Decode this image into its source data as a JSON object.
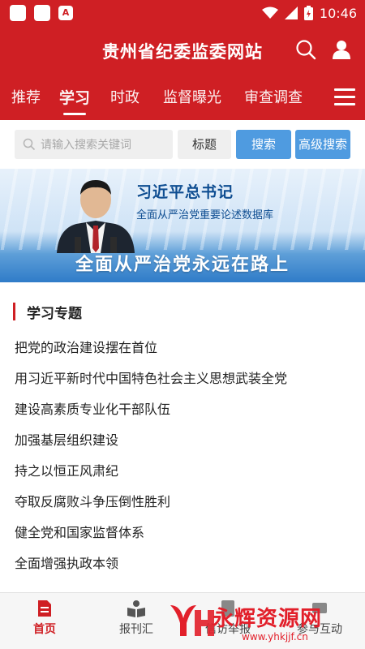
{
  "status_bar": {
    "time": "10:46",
    "notif_badge": "A"
  },
  "header": {
    "title": "贵州省纪委监委网站",
    "icons": [
      "search-icon",
      "user-icon"
    ]
  },
  "tabs": [
    {
      "label": "推荐",
      "active": false
    },
    {
      "label": "学习",
      "active": true
    },
    {
      "label": "时政",
      "active": false
    },
    {
      "label": "监督曝光",
      "active": false
    },
    {
      "label": "审查调查",
      "active": false
    }
  ],
  "search": {
    "placeholder": "请输入搜索关键词",
    "scope": "标题",
    "search_label": "搜索",
    "advanced_label": "高级搜索"
  },
  "banner": {
    "title": "习近平总书记",
    "subtitle": "全面从严治党重要论述数据库",
    "slogan": "全面从严治党永远在路上"
  },
  "study": {
    "section_title": "学习专题",
    "topics": [
      "把党的政治建设摆在首位",
      "用习近平新时代中国特色社会主义思想武装全党",
      "建设高素质专业化干部队伍",
      "加强基层组织建设",
      "持之以恒正风肃纪",
      "夺取反腐败斗争压倒性胜利",
      "健全党和国家监督体系",
      "全面增强执政本领"
    ]
  },
  "bottom_nav": [
    {
      "label": "首页",
      "icon": "home-doc-icon",
      "active": true
    },
    {
      "label": "报刊汇",
      "icon": "book-reader-icon",
      "active": false
    },
    {
      "label": "信访举报",
      "icon": "report-icon",
      "active": false
    },
    {
      "label": "参与互动",
      "icon": "interaction-icon",
      "active": false
    }
  ],
  "watermark": {
    "text": "永辉资源网",
    "url": "www.yhkjjf.cn"
  },
  "colors": {
    "brand_red": "#cf1f24",
    "button_blue": "#4f9be0"
  }
}
